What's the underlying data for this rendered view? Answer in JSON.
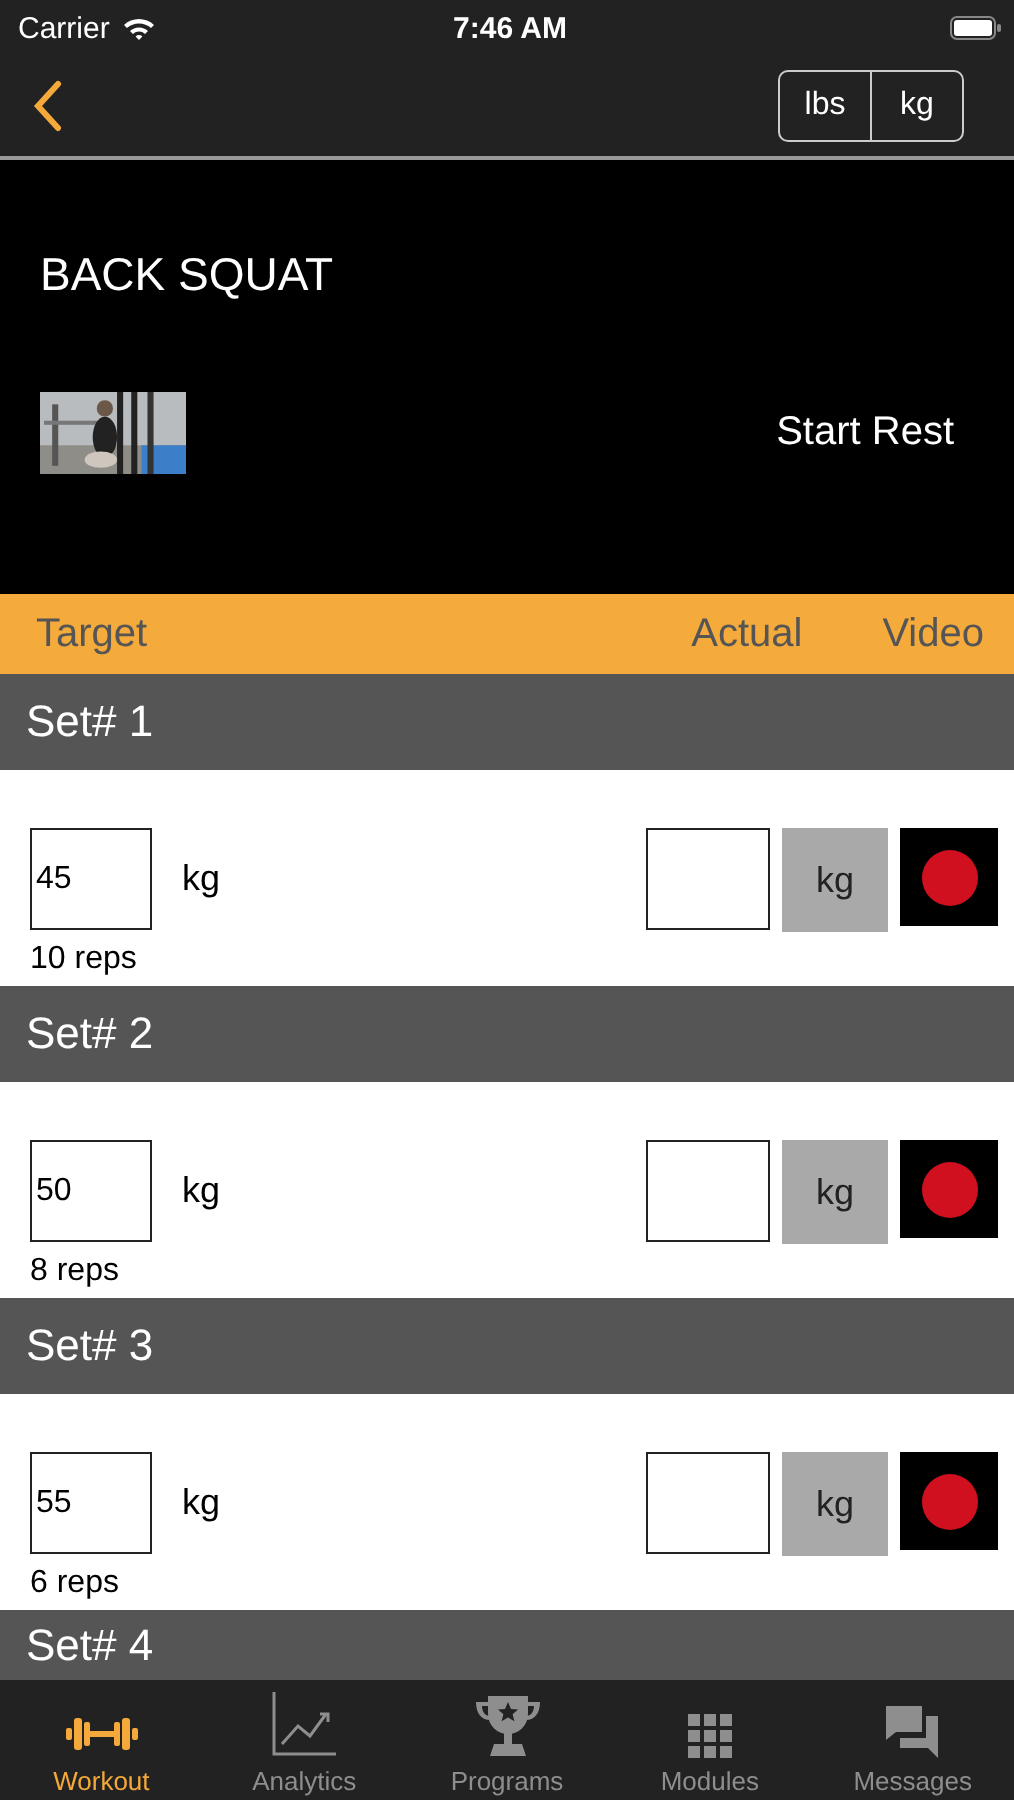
{
  "status_bar": {
    "carrier": "Carrier",
    "time": "7:46 AM"
  },
  "units": [
    "lbs",
    "kg"
  ],
  "exercise": {
    "title": "BACK SQUAT",
    "rest_button": "Start Rest"
  },
  "columns": [
    "Target",
    "Actual",
    "Video"
  ],
  "sets": [
    {
      "label": "Set# 1",
      "target": "45",
      "unit": "kg",
      "reps": "10 reps",
      "actual_unit": "kg"
    },
    {
      "label": "Set# 2",
      "target": "50",
      "unit": "kg",
      "reps": "8 reps",
      "actual_unit": "kg"
    },
    {
      "label": "Set# 3",
      "target": "55",
      "unit": "kg",
      "reps": "6 reps",
      "actual_unit": "kg"
    }
  ],
  "next_set": {
    "label": "Set# 4"
  },
  "tabs": [
    {
      "label": "Workout",
      "kind": "dumbbell",
      "selected": true
    },
    {
      "label": "Analytics",
      "kind": "chart",
      "selected": false
    },
    {
      "label": "Programs",
      "kind": "trophy",
      "selected": false
    },
    {
      "label": "Modules",
      "kind": "grid",
      "selected": false
    },
    {
      "label": "Messages",
      "kind": "chat",
      "selected": false
    }
  ]
}
